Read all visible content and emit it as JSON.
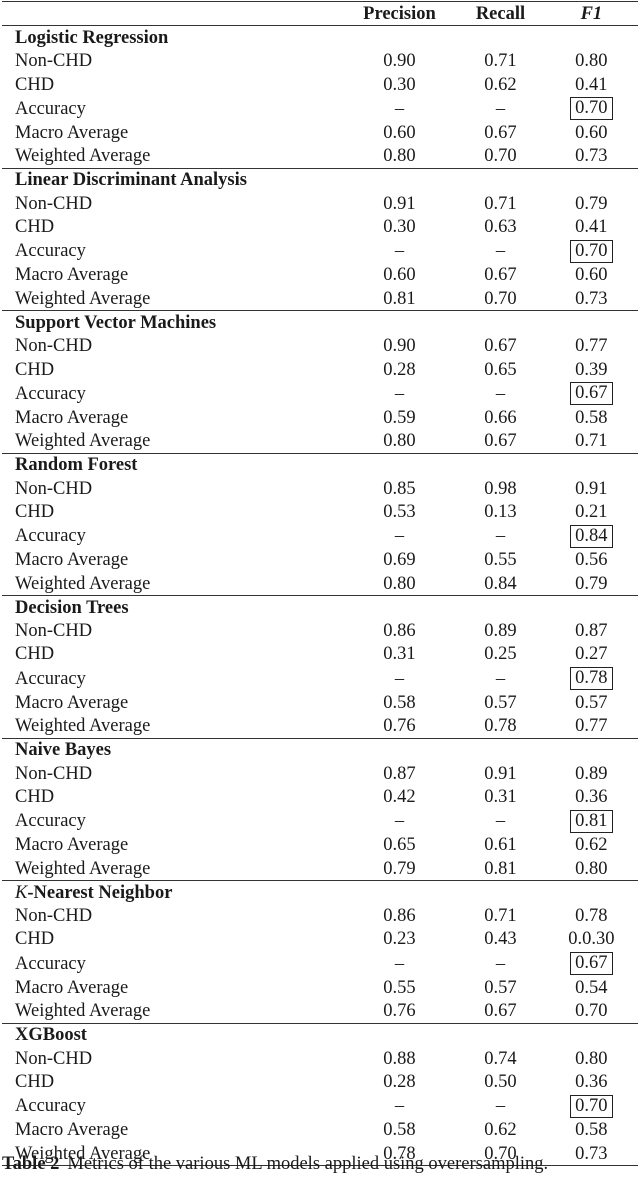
{
  "table": {
    "columns": [
      "",
      "Precision",
      "Recall",
      "F1"
    ],
    "models": [
      {
        "name": "Logistic Regression",
        "rows": [
          {
            "label": "Non-CHD",
            "precision": "0.90",
            "recall": "0.71",
            "f1": "0.80"
          },
          {
            "label": "CHD",
            "precision": "0.30",
            "recall": "0.62",
            "f1": "0.41"
          },
          {
            "label": "Accuracy",
            "precision": "–",
            "recall": "–",
            "f1": "0.70"
          },
          {
            "label": "Macro Average",
            "precision": "0.60",
            "recall": "0.67",
            "f1": "0.60"
          },
          {
            "label": "Weighted Average",
            "precision": "0.80",
            "recall": "0.70",
            "f1": "0.73"
          }
        ]
      },
      {
        "name": "Linear Discriminant Analysis",
        "rows": [
          {
            "label": "Non-CHD",
            "precision": "0.91",
            "recall": "0.71",
            "f1": "0.79"
          },
          {
            "label": "CHD",
            "precision": "0.30",
            "recall": "0.63",
            "f1": "0.41"
          },
          {
            "label": "Accuracy",
            "precision": "–",
            "recall": "–",
            "f1": "0.70"
          },
          {
            "label": "Macro Average",
            "precision": "0.60",
            "recall": "0.67",
            "f1": "0.60"
          },
          {
            "label": "Weighted Average",
            "precision": "0.81",
            "recall": "0.70",
            "f1": "0.73"
          }
        ]
      },
      {
        "name": "Support Vector Machines",
        "rows": [
          {
            "label": "Non-CHD",
            "precision": "0.90",
            "recall": "0.67",
            "f1": "0.77"
          },
          {
            "label": "CHD",
            "precision": "0.28",
            "recall": "0.65",
            "f1": "0.39"
          },
          {
            "label": "Accuracy",
            "precision": "–",
            "recall": "–",
            "f1": "0.67"
          },
          {
            "label": "Macro Average",
            "precision": "0.59",
            "recall": "0.66",
            "f1": "0.58"
          },
          {
            "label": "Weighted Average",
            "precision": "0.80",
            "recall": "0.67",
            "f1": "0.71"
          }
        ]
      },
      {
        "name": "Random Forest",
        "rows": [
          {
            "label": "Non-CHD",
            "precision": "0.85",
            "recall": "0.98",
            "f1": "0.91"
          },
          {
            "label": "CHD",
            "precision": "0.53",
            "recall": "0.13",
            "f1": "0.21"
          },
          {
            "label": "Accuracy",
            "precision": "–",
            "recall": "–",
            "f1": "0.84"
          },
          {
            "label": "Macro Average",
            "precision": "0.69",
            "recall": "0.55",
            "f1": "0.56"
          },
          {
            "label": "Weighted Average",
            "precision": "0.80",
            "recall": "0.84",
            "f1": "0.79"
          }
        ]
      },
      {
        "name": "Decision Trees",
        "rows": [
          {
            "label": "Non-CHD",
            "precision": "0.86",
            "recall": "0.89",
            "f1": "0.87"
          },
          {
            "label": "CHD",
            "precision": "0.31",
            "recall": "0.25",
            "f1": "0.27"
          },
          {
            "label": "Accuracy",
            "precision": "–",
            "recall": "–",
            "f1": "0.78"
          },
          {
            "label": "Macro Average",
            "precision": "0.58",
            "recall": "0.57",
            "f1": "0.57"
          },
          {
            "label": "Weighted Average",
            "precision": "0.76",
            "recall": "0.78",
            "f1": "0.77"
          }
        ]
      },
      {
        "name": "Naive Bayes",
        "rows": [
          {
            "label": "Non-CHD",
            "precision": "0.87",
            "recall": "0.91",
            "f1": "0.89"
          },
          {
            "label": "CHD",
            "precision": "0.42",
            "recall": "0.31",
            "f1": "0.36"
          },
          {
            "label": "Accuracy",
            "precision": "–",
            "recall": "–",
            "f1": "0.81"
          },
          {
            "label": "Macro Average",
            "precision": "0.65",
            "recall": "0.61",
            "f1": "0.62"
          },
          {
            "label": "Weighted Average",
            "precision": "0.79",
            "recall": "0.81",
            "f1": "0.80"
          }
        ]
      },
      {
        "name_prefix": "K",
        "name": "-Nearest Neighbor",
        "rows": [
          {
            "label": "Non-CHD",
            "precision": "0.86",
            "recall": "0.71",
            "f1": "0.78"
          },
          {
            "label": "CHD",
            "precision": "0.23",
            "recall": "0.43",
            "f1": "0.0.30"
          },
          {
            "label": "Accuracy",
            "precision": "–",
            "recall": "–",
            "f1": "0.67"
          },
          {
            "label": "Macro Average",
            "precision": "0.55",
            "recall": "0.57",
            "f1": "0.54"
          },
          {
            "label": "Weighted Average",
            "precision": "0.76",
            "recall": "0.67",
            "f1": "0.70"
          }
        ]
      },
      {
        "name": "XGBoost",
        "rows": [
          {
            "label": "Non-CHD",
            "precision": "0.88",
            "recall": "0.74",
            "f1": "0.80"
          },
          {
            "label": "CHD",
            "precision": "0.28",
            "recall": "0.50",
            "f1": "0.36"
          },
          {
            "label": "Accuracy",
            "precision": "–",
            "recall": "–",
            "f1": "0.70"
          },
          {
            "label": "Macro Average",
            "precision": "0.58",
            "recall": "0.62",
            "f1": "0.58"
          },
          {
            "label": "Weighted Average",
            "precision": "0.78",
            "recall": "0.70",
            "f1": "0.73"
          }
        ]
      }
    ]
  },
  "caption": {
    "label": "Table 2",
    "text": "Metrics of the various ML models applied using overersampling."
  }
}
